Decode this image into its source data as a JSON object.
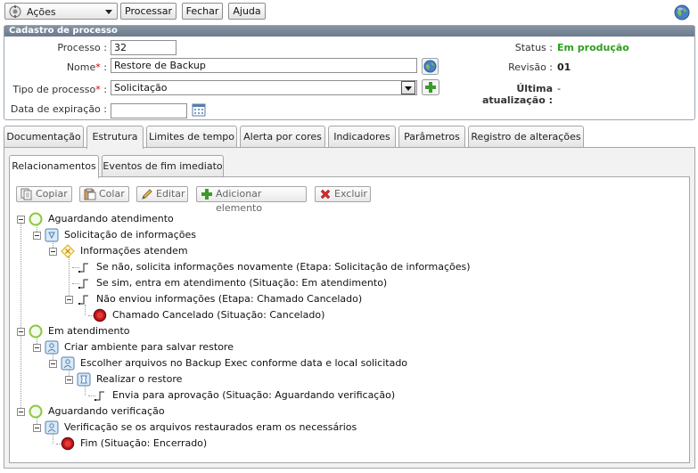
{
  "toolbar": {
    "actions_label": "Ações",
    "process_button": "Processar",
    "close_button": "Fechar",
    "help_button": "Ajuda"
  },
  "panel": {
    "title": "Cadastro de processo",
    "processo_label": "Processo :",
    "processo_value": "32",
    "nome_label": "Nome",
    "nome_suffix": ":",
    "nome_value": "Restore de Backup",
    "tipo_label": "Tipo de processo",
    "tipo_suffix": ":",
    "tipo_value": "Solicitação",
    "expiracao_label": "Data de expiração :",
    "expiracao_value": "",
    "status_label": "Status :",
    "status_value": "Em produção",
    "status_color": "#2e9e1e",
    "revisao_label": "Revisão :",
    "revisao_value": "01",
    "ultima_label": "Última atualização :",
    "ultima_value": "-"
  },
  "tabs": [
    {
      "label": "Documentação"
    },
    {
      "label": "Estrutura"
    },
    {
      "label": "Limites de tempo"
    },
    {
      "label": "Alerta por cores"
    },
    {
      "label": "Indicadores"
    },
    {
      "label": "Parâmetros"
    },
    {
      "label": "Registro de alterações"
    }
  ],
  "subtabs": [
    {
      "label": "Relacionamentos"
    },
    {
      "label": "Eventos de fim imediato"
    }
  ],
  "actions": {
    "copy": "Copiar",
    "paste": "Colar",
    "edit": "Editar",
    "add": "Adicionar elemento",
    "delete": "Excluir"
  },
  "tree": [
    {
      "label": "Aguardando atendimento",
      "icon": "start-circle-icon"
    },
    {
      "label": "Solicitação de informações",
      "icon": "activity-icon"
    },
    {
      "label": "Informações atendem",
      "icon": "decision-icon"
    },
    {
      "label": "Se não, solicita informações novamente (Etapa: Solicitação de informações)",
      "icon": "flow-icon"
    },
    {
      "label": "Se sim, entra em atendimento (Situação: Em atendimento)",
      "icon": "flow-icon"
    },
    {
      "label": "Não enviou informações (Etapa: Chamado Cancelado)",
      "icon": "flow-icon"
    },
    {
      "label": "Chamado Cancelado (Situação: Cancelado)",
      "icon": "end-circle-icon"
    },
    {
      "label": "Em atendimento",
      "icon": "start-circle-icon"
    },
    {
      "label": "Criar ambiente para salvar restore",
      "icon": "user-task-icon"
    },
    {
      "label": "Escolher arquivos no Backup Exec conforme data e local solicitado",
      "icon": "user-task-icon"
    },
    {
      "label": "Realizar o restore",
      "icon": "script-task-icon"
    },
    {
      "label": "Envia para aprovação (Situação: Aguardando verificação)",
      "icon": "flow-icon"
    },
    {
      "label": "Aguardando verificação",
      "icon": "start-circle-icon"
    },
    {
      "label": "Verificação se os arquivos restaurados eram os necessários",
      "icon": "user-task-icon"
    },
    {
      "label": "Fim (Situação: Encerrado)",
      "icon": "end-circle-icon"
    }
  ]
}
